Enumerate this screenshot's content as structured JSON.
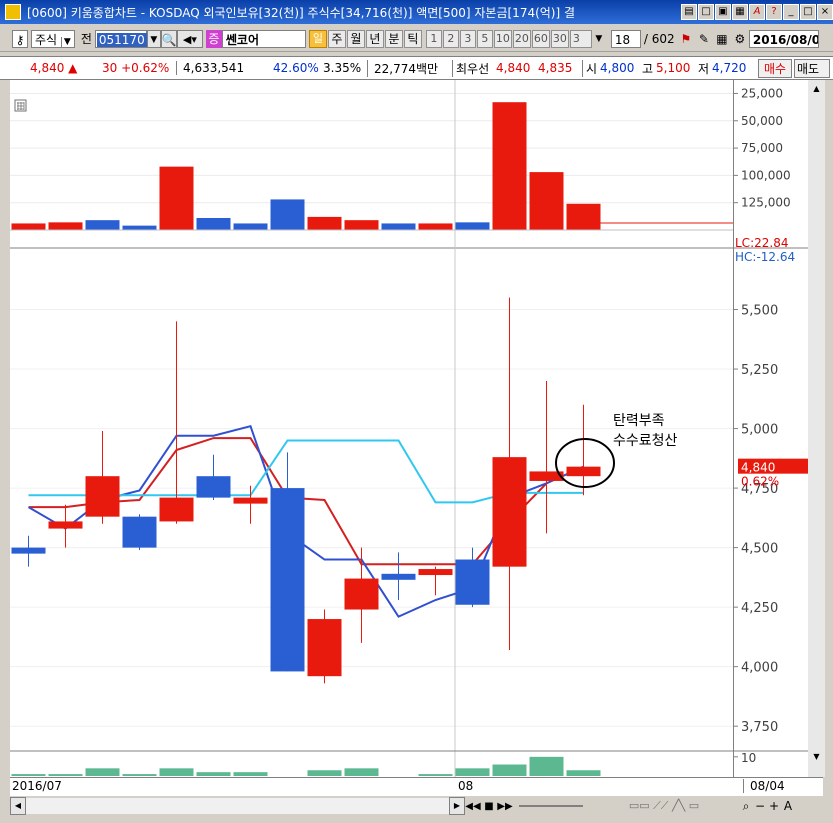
{
  "window": {
    "title": "[0600] 키움종합차트 - KOSDAQ 외국인보유[32(천)] 주식수[34,716(천)] 액면[500] 자본금[174(억)] 결"
  },
  "toolbar": {
    "market": "주식",
    "jeon": "전",
    "code": "051170",
    "name": "쎈코어",
    "periods": [
      "일",
      "주",
      "월",
      "년",
      "분",
      "틱"
    ],
    "tick_buttons": [
      "1",
      "2",
      "3",
      "5",
      "10",
      "20",
      "60",
      "30",
      "3"
    ],
    "count": "18",
    "total": "/ 602",
    "date": "2016/08/0"
  },
  "info": {
    "price": "4,840 ▲",
    "change": "30 +0.62%",
    "volume": "4,633,541",
    "vol_ratio": "42.60%",
    "turnover": "3.35%",
    "amount": "22,774백만",
    "best_label": "최우선",
    "best_ask": "4,840",
    "best_bid": "4,835",
    "open_label": "시",
    "open": "4,800",
    "high_label": "고",
    "high": "5,100",
    "low_label": "저",
    "low": "4,720",
    "buy_btn": "매수",
    "sell_btn": "매도"
  },
  "annotation": {
    "line1": "탄력부족",
    "line2": "수수료청산"
  },
  "lines_labels": {
    "lc": "LC:22.84",
    "hc": "HC:-12.64"
  },
  "current_price": {
    "price": "4,840",
    "pct": "0.62%"
  },
  "volume_scale": [
    "125,000",
    "100,000",
    "75,000",
    "50,000",
    "25,000"
  ],
  "bottom_axis": {
    "start": "2016/07",
    "mid": "08",
    "end": "08/04",
    "lower_scale": "10"
  },
  "colors": {
    "up": "#e81a0e",
    "down": "#2a5fd4",
    "red_line": "#d42020",
    "blue_line": "#3050d0",
    "cyan_line": "#30c8f0",
    "sub_bar": "#5cb890"
  },
  "chart_data": [
    {
      "type": "bar",
      "title": "volume",
      "ylim": [
        0,
        130000
      ],
      "y_ticks": [
        25000,
        50000,
        75000,
        100000,
        125000
      ],
      "values": [
        6000,
        7000,
        9000,
        4000,
        58000,
        11000,
        6000,
        28000,
        12000,
        9000,
        6000,
        6000,
        7000,
        117000,
        53000,
        24000
      ],
      "colors": [
        "up",
        "up",
        "down",
        "down",
        "up",
        "down",
        "down",
        "down",
        "up",
        "up",
        "down",
        "up",
        "down",
        "up",
        "up",
        "up"
      ]
    },
    {
      "type": "candlestick",
      "title": "price",
      "ylim": [
        3650,
        5750
      ],
      "y_ticks": [
        3750,
        4000,
        4250,
        4500,
        4750,
        5000,
        5250,
        5500
      ],
      "candles": [
        {
          "o": 4500,
          "c": 4490,
          "h": 4550,
          "l": 4420
        },
        {
          "o": 4580,
          "c": 4610,
          "h": 4680,
          "l": 4500
        },
        {
          "o": 4630,
          "c": 4800,
          "h": 4990,
          "l": 4600
        },
        {
          "o": 4630,
          "c": 4500,
          "h": 4640,
          "l": 4490
        },
        {
          "o": 4610,
          "c": 4710,
          "h": 5450,
          "l": 4600
        },
        {
          "o": 4800,
          "c": 4710,
          "h": 4890,
          "l": 4700
        },
        {
          "o": 4710,
          "c": 4710,
          "h": 4760,
          "l": 4600
        },
        {
          "o": 4750,
          "c": 3980,
          "h": 4900,
          "l": 3980
        },
        {
          "o": 3960,
          "c": 4200,
          "h": 4240,
          "l": 3930
        },
        {
          "o": 4240,
          "c": 4370,
          "h": 4500,
          "l": 4100
        },
        {
          "o": 4390,
          "c": 4370,
          "h": 4480,
          "l": 4280
        },
        {
          "o": 4400,
          "c": 4410,
          "h": 4420,
          "l": 4300
        },
        {
          "o": 4450,
          "c": 4260,
          "h": 4500,
          "l": 4250
        },
        {
          "o": 4420,
          "c": 4880,
          "h": 5550,
          "l": 4070
        },
        {
          "o": 4780,
          "c": 4820,
          "h": 5200,
          "l": 4560
        },
        {
          "o": 4800,
          "c": 4840,
          "h": 5100,
          "l": 4720
        }
      ],
      "series": [
        {
          "values": [
            4670,
            4670,
            4690,
            4700,
            4910,
            4960,
            4960,
            4710,
            4700,
            4430,
            4430,
            4430,
            4430,
            4610,
            4770,
            null
          ]
        },
        {
          "values": [
            4670,
            4580,
            4700,
            4740,
            4970,
            4970,
            5010,
            4560,
            4450,
            4450,
            4210,
            4280,
            4330,
            4710,
            4770,
            4840
          ]
        },
        {
          "values": [
            4720,
            4720,
            4720,
            4720,
            4720,
            4720,
            4720,
            4950,
            4950,
            4950,
            4950,
            4690,
            4690,
            4730,
            4730,
            4730
          ]
        }
      ]
    },
    {
      "type": "bar",
      "title": "sub",
      "ylim": [
        0,
        12
      ],
      "y_ticks": [
        10
      ],
      "values": [
        1,
        1,
        4,
        1,
        4,
        2,
        2,
        0,
        3,
        4,
        0,
        1,
        4,
        6,
        10,
        3
      ]
    }
  ]
}
